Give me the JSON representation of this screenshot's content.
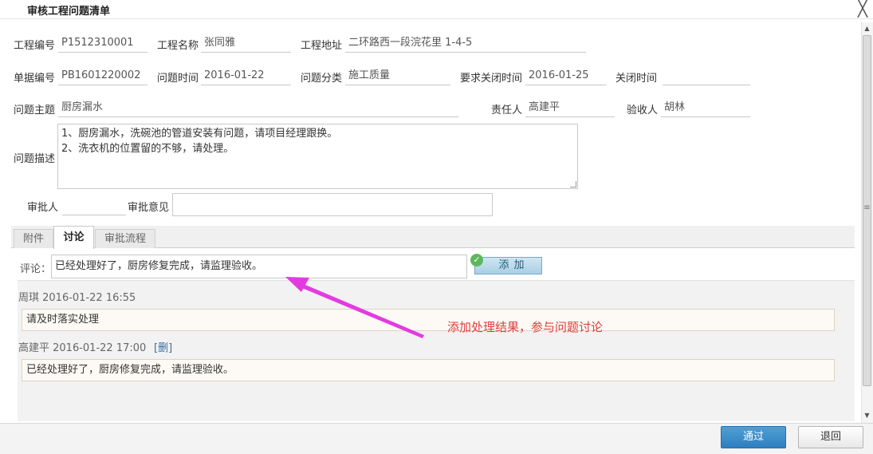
{
  "window": {
    "title": "审核工程问题清单",
    "close_glyph": "╳"
  },
  "form": {
    "project_no_label": "工程编号",
    "project_no": "P1512310001",
    "project_name_label": "工程名称",
    "project_name": "张同雅",
    "project_addr_label": "工程地址",
    "project_addr": "二环路西一段浣花里 1-4-5",
    "doc_no_label": "单据编号",
    "doc_no": "PB1601220002",
    "issue_time_label": "问题时间",
    "issue_time": "2016-01-22",
    "issue_cat_label": "问题分类",
    "issue_cat": "施工质量",
    "req_close_label": "要求关闭时间",
    "req_close": "2016-01-25",
    "close_time_label": "关闭时间",
    "close_time": "",
    "subject_label": "问题主题",
    "subject": "厨房漏水",
    "owner_label": "责任人",
    "owner": "高建平",
    "acceptor_label": "验收人",
    "acceptor": "胡林",
    "desc_label": "问题描述",
    "desc_line1": "1、厨房漏水，洗碗池的管道安装有问题，请项目经理跟换。",
    "desc_line2": "2、洗衣机的位置留的不够，请处理。",
    "approver_label": "审批人",
    "approver": "",
    "approval_opinion_label": "审批意见",
    "approval_opinion": ""
  },
  "tabs": [
    {
      "label": "附件",
      "active": false
    },
    {
      "label": "讨论",
      "active": true
    },
    {
      "label": "审批流程",
      "active": false
    }
  ],
  "comment": {
    "label": "评论：",
    "value": "已经处理好了，厨房修复完成，请监理验收。",
    "add_button": "添加"
  },
  "discussion": [
    {
      "author": "周琪 2016-01-22 16:55",
      "text": "请及时落实处理",
      "delete_link": ""
    },
    {
      "author": "高建平 2016-01-22 17:00",
      "text": "已经处理好了，厨房修复完成，请监理验收。",
      "delete_link": "[删]"
    }
  ],
  "annotation": {
    "text": "添加处理结果，参与问题讨论",
    "color": "#e23c3c",
    "arrow_color": "#e23ce0"
  },
  "buttons": {
    "pass": "通过",
    "back": "退回"
  },
  "colors": {
    "primary_button": "#2f7fbf",
    "add_button": "#a9cfe3"
  }
}
